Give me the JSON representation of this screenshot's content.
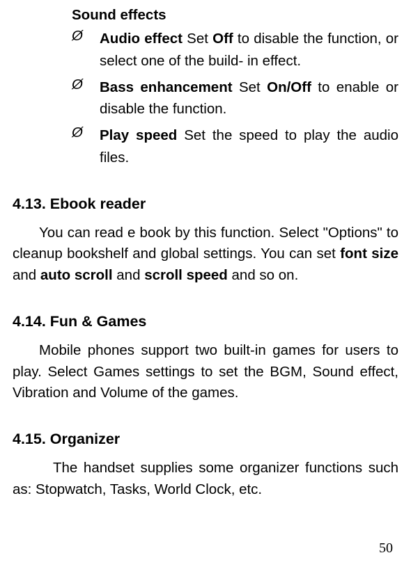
{
  "sound_effects": {
    "title": "Sound effects",
    "bullet_symbol": "Ø",
    "items": [
      {
        "label": "Audio effect",
        "sp": "    ",
        "pre": "Set ",
        "bold": "Off",
        "post": " to disable the function, or select one of the build- in effect."
      },
      {
        "label": "Bass enhancement",
        "sp": "     ",
        "pre": "Set ",
        "bold": "On/Off",
        "post": " to enable or disable the function."
      },
      {
        "label": "Play speed",
        "sp": "  ",
        "pre": "Set the speed to play the audio files.",
        "bold": "",
        "post": ""
      }
    ]
  },
  "ebook": {
    "heading": "4.13. Ebook reader",
    "p1": "You can read e book by this function. Select \"Options\" to cleanup bookshelf and global settings. You can set ",
    "b1": "font size",
    "p2": " and ",
    "b2": "auto scroll",
    "p3": " and ",
    "b3": "scroll speed",
    "p4": " and so on."
  },
  "fun": {
    "heading": "4.14.  Fun & Games",
    "para": "Mobile phones support two built-in games for users to play. Select Games settings to set the BGM, Sound effect, Vibration and Volume of the games."
  },
  "organizer": {
    "heading": "4.15.  Organizer",
    "para": "The handset supplies some organizer functions such as: Stopwatch, Tasks, World Clock, etc."
  },
  "page_number": "50"
}
